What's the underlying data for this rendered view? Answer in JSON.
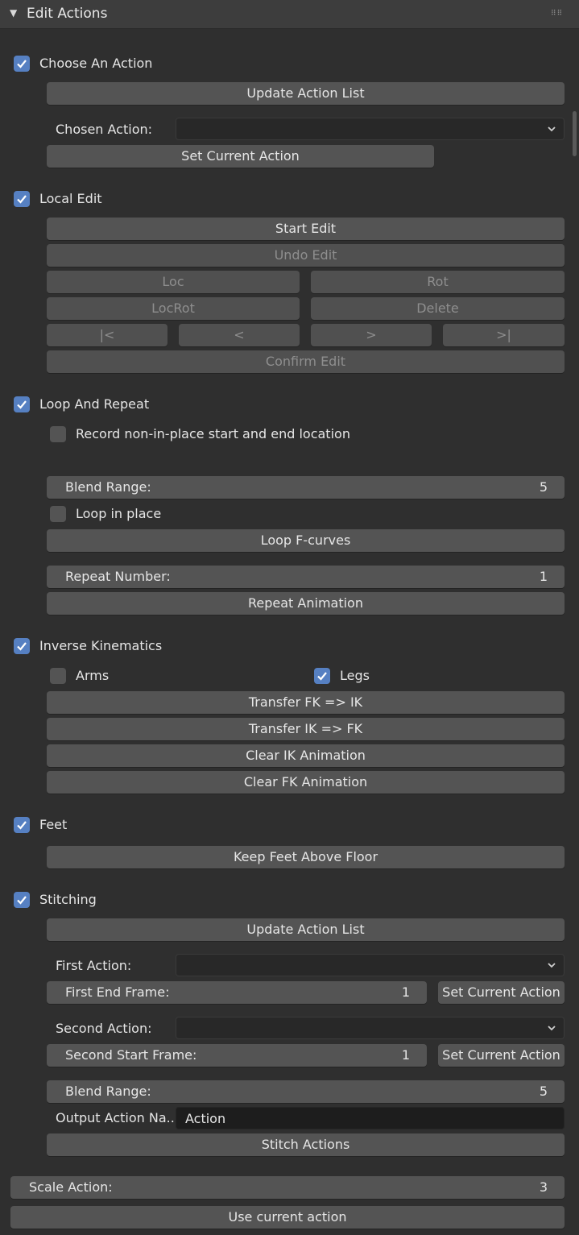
{
  "panel": {
    "title": "Edit Actions"
  },
  "choose_action": {
    "label": "Choose An Action",
    "checked": true,
    "update_btn": "Update Action List",
    "chosen_label": "Chosen Action:",
    "chosen_value": "",
    "set_btn": "Set Current Action"
  },
  "local_edit": {
    "label": "Local Edit",
    "checked": true,
    "start": "Start Edit",
    "undo": "Undo Edit",
    "loc": "Loc",
    "rot": "Rot",
    "locrot": "LocRot",
    "delete": "Delete",
    "first": "|<",
    "prev": "<",
    "next": ">",
    "last": ">|",
    "confirm": "Confirm Edit"
  },
  "loop_repeat": {
    "label": "Loop And Repeat",
    "checked": true,
    "record_label": "Record non-in-place start and end location",
    "record_checked": false,
    "blend_label": "Blend Range:",
    "blend_value": "5",
    "loop_in_place_label": "Loop in place",
    "loop_in_place_checked": false,
    "loop_btn": "Loop F-curves",
    "repeat_label": "Repeat Number:",
    "repeat_value": "1",
    "repeat_btn": "Repeat Animation"
  },
  "ik": {
    "label": "Inverse Kinematics",
    "checked": true,
    "arms_label": "Arms",
    "arms_checked": false,
    "legs_label": "Legs",
    "legs_checked": true,
    "fk_to_ik": "Transfer FK => IK",
    "ik_to_fk": "Transfer IK => FK",
    "clear_ik": "Clear IK Animation",
    "clear_fk": "Clear FK Animation"
  },
  "feet": {
    "label": "Feet",
    "checked": true,
    "keep_btn": "Keep Feet Above Floor"
  },
  "stitching": {
    "label": "Stitching",
    "checked": true,
    "update_btn": "Update Action List",
    "first_action_label": "First Action:",
    "first_action_value": "",
    "first_end_label": "First End Frame:",
    "first_end_value": "1",
    "set_first_btn": "Set Current Action",
    "second_action_label": "Second Action:",
    "second_action_value": "",
    "second_start_label": "Second Start Frame:",
    "second_start_value": "1",
    "set_second_btn": "Set Current Action",
    "blend_label": "Blend Range:",
    "blend_value": "5",
    "output_label": "Output Action Na..",
    "output_value": "Action",
    "stitch_btn": "Stitch Actions"
  },
  "scale": {
    "label": "Scale Action:",
    "value": "3",
    "use_current_btn": "Use current action"
  },
  "colors": {
    "background": "#2f2f2f",
    "button": "#545454",
    "checkbox_on": "#5680c2",
    "checkbox_off": "#545454",
    "text": "#e6e6e6",
    "text_disabled": "#8e8e8e",
    "select_bg": "#282828",
    "text_input_bg": "#1d1d1d"
  },
  "icons": {
    "collapse": "triangle-down-icon",
    "drag": "grip-dots-icon",
    "check": "checkmark-icon",
    "dropdown": "chevron-down-icon"
  }
}
